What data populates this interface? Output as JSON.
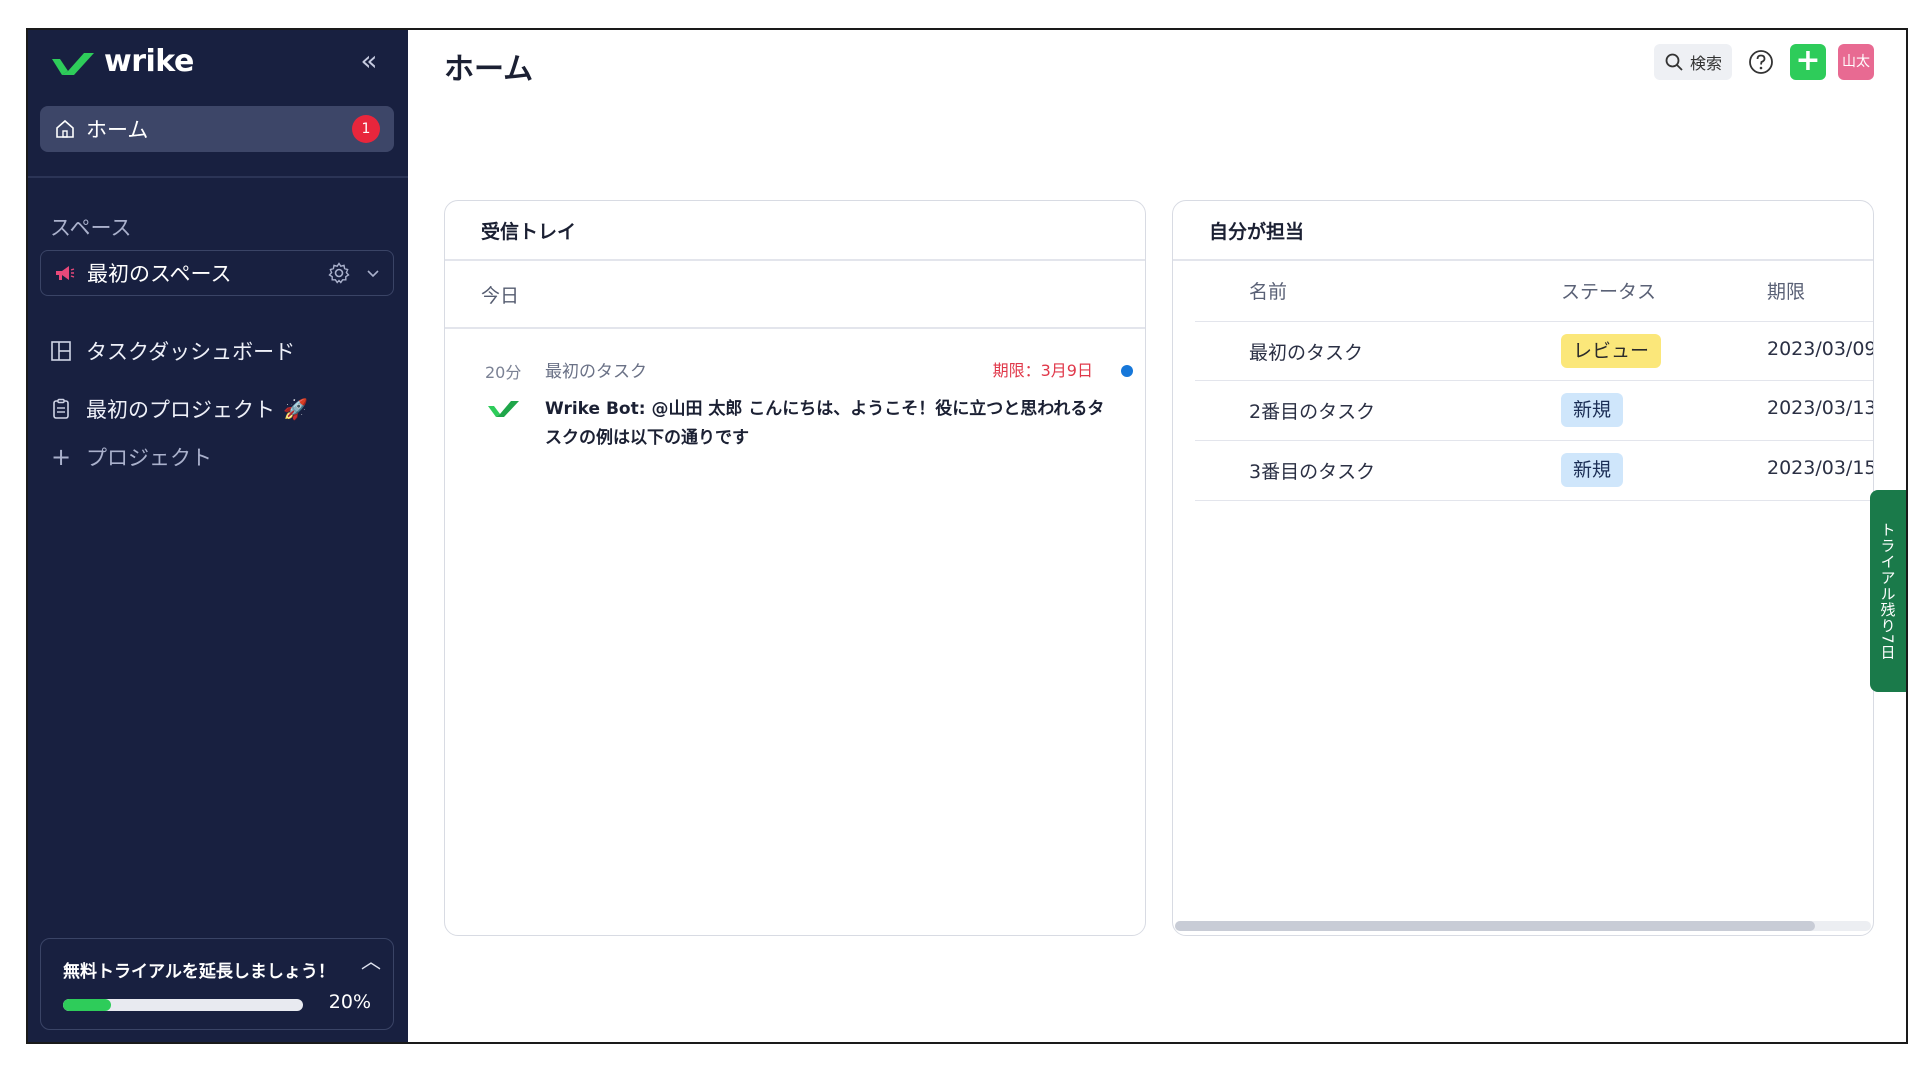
{
  "sidebar": {
    "logo_text": "wrike",
    "home": {
      "label": "ホーム",
      "badge": "1"
    },
    "spaces_header": "スペース",
    "space": {
      "label": "最初のスペース"
    },
    "nav": {
      "dashboard": "タスクダッシュボード",
      "project": "最初のプロジェクト",
      "project_emoji": "🚀",
      "add_project": "プロジェクト"
    },
    "trial": {
      "title": "無料トライアルを延長しましょう！",
      "percent": "20%",
      "progress": 0.2
    }
  },
  "header": {
    "title": "ホーム",
    "search_label": "検索",
    "avatar": "山太"
  },
  "inbox": {
    "title": "受信トレイ",
    "group": "今日",
    "messages": [
      {
        "time": "20分",
        "task": "最初のタスク",
        "due": "期限：3月9日",
        "text": "Wrike Bot: @山田 太郎 こんにちは、ようこそ！役に立つと思われるタスクの例は以下の通りです"
      }
    ]
  },
  "assigned": {
    "title": "自分が担当",
    "columns": {
      "name": "名前",
      "status": "ステータス",
      "due": "期限"
    },
    "rows": [
      {
        "name": "最初のタスク",
        "status": "レビュー",
        "due": "2023/03/09"
      },
      {
        "name": "2番目のタスク",
        "status": "新規",
        "due": "2023/03/13"
      },
      {
        "name": "3番目のタスク",
        "status": "新規",
        "due": "2023/03/15"
      }
    ]
  },
  "trial_tab": "トライアル残り7日",
  "colors": {
    "sidebar_bg": "#182040",
    "accent_green": "#2ecc5a",
    "badge_red": "#e8263c",
    "review_yellow": "#fbe77a",
    "new_blue": "#cfe6fb",
    "trial_tab_green": "#1a7a4a"
  },
  "icons": {
    "logo": "wrike-check-logo",
    "home": "home-icon",
    "collapse": "double-chevron-left-icon",
    "space": "megaphone-icon",
    "gear": "gear-icon",
    "chevron": "chevron-down-icon",
    "dashboard": "dashboard-icon",
    "project": "clipboard-icon",
    "plus": "plus-icon",
    "search": "search-icon",
    "help": "help-icon"
  }
}
